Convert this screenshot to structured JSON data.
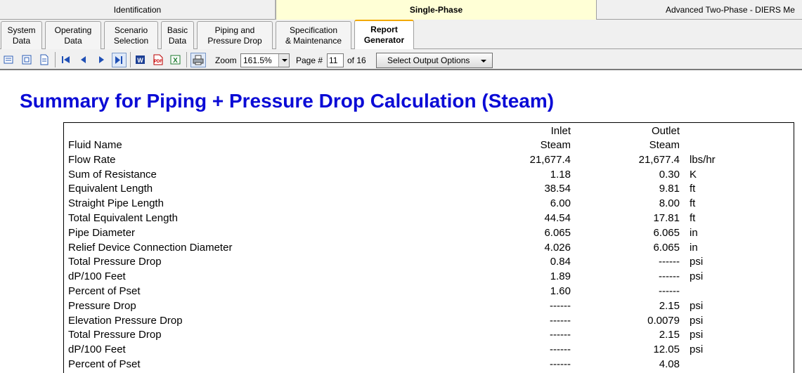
{
  "mode_tabs": [
    "Identification",
    "Single-Phase",
    "Advanced Two-Phase - DIERS Me"
  ],
  "sub_tabs": [
    {
      "line1": "System",
      "line2": "Data"
    },
    {
      "line1": "Operating",
      "line2": "Data"
    },
    {
      "line1": "Scenario",
      "line2": "Selection"
    },
    {
      "line1": "Basic",
      "line2": "Data"
    },
    {
      "line1": "Piping and",
      "line2": "Pressure Drop"
    },
    {
      "line1": "Specification",
      "line2": "& Maintenance"
    },
    {
      "line1": "Report",
      "line2": "Generator"
    }
  ],
  "toolbar": {
    "zoom_label": "Zoom",
    "zoom_value": "161.5%",
    "page_label": "Page #",
    "page_value": "11",
    "page_total": "of 16",
    "select_output": "Select Output Options"
  },
  "report": {
    "title": "Summary for Piping + Pressure Drop Calculation (Steam)",
    "col_inlet": "Inlet",
    "col_outlet": "Outlet",
    "rows": [
      {
        "name": "Fluid Name",
        "inlet": "Steam",
        "outlet": "Steam",
        "unit": ""
      },
      {
        "name": "Flow Rate",
        "inlet": "21,677.4",
        "outlet": "21,677.4",
        "unit": "lbs/hr"
      },
      {
        "name": "Sum of Resistance",
        "inlet": "1.18",
        "outlet": "0.30",
        "unit": "K"
      },
      {
        "name": "Equivalent Length",
        "inlet": "38.54",
        "outlet": "9.81",
        "unit": "ft"
      },
      {
        "name": "Straight Pipe Length",
        "inlet": "6.00",
        "outlet": "8.00",
        "unit": "ft"
      },
      {
        "name": "Total Equivalent Length",
        "inlet": "44.54",
        "outlet": "17.81",
        "unit": "ft"
      },
      {
        "name": "Pipe Diameter",
        "inlet": "6.065",
        "outlet": "6.065",
        "unit": "in"
      },
      {
        "name": "Relief Device Connection Diameter",
        "inlet": "4.026",
        "outlet": "6.065",
        "unit": "in"
      },
      {
        "name": "Total Pressure Drop",
        "inlet": "0.84",
        "outlet": "------",
        "unit": "psi"
      },
      {
        "name": "dP/100 Feet",
        "inlet": "1.89",
        "outlet": "------",
        "unit": "psi"
      },
      {
        "name": "Percent of Pset",
        "inlet": "1.60",
        "outlet": "------",
        "unit": ""
      },
      {
        "name": "Pressure Drop",
        "inlet": "------",
        "outlet": "2.15",
        "unit": "psi"
      },
      {
        "name": "Elevation Pressure Drop",
        "inlet": "------",
        "outlet": "0.0079",
        "unit": "psi"
      },
      {
        "name": "Total Pressure Drop",
        "inlet": "------",
        "outlet": "2.15",
        "unit": "psi"
      },
      {
        "name": "dP/100 Feet",
        "inlet": "------",
        "outlet": "12.05",
        "unit": "psi"
      },
      {
        "name": "Percent of Pset",
        "inlet": "------",
        "outlet": "4.08",
        "unit": ""
      }
    ]
  },
  "colors": {
    "title": "#0b0bd6",
    "active_mode_tab": "#ffffd6",
    "active_sub_tab_accent": "#f2a900"
  }
}
